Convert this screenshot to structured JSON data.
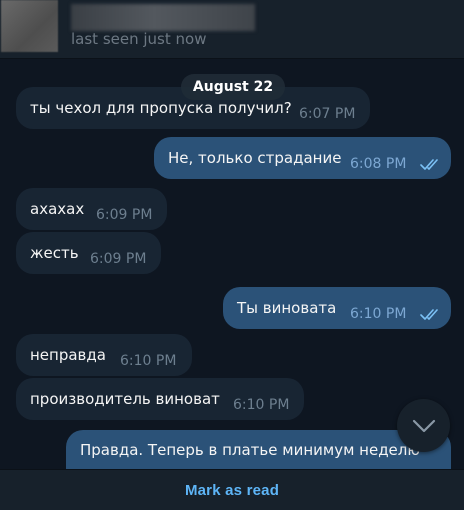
{
  "header": {
    "status": "last seen just now"
  },
  "chat": {
    "date_divider": "August 22",
    "messages": [
      {
        "text": "ты чехол для пропуска получил?",
        "time": "6:07 PM",
        "direction": "incoming"
      },
      {
        "text": "Не, только страдание",
        "time": "6:08 PM",
        "direction": "outgoing",
        "read": true
      },
      {
        "text": "ахахах",
        "time": "6:09 PM",
        "direction": "incoming"
      },
      {
        "text": "жесть",
        "time": "6:09 PM",
        "direction": "incoming"
      },
      {
        "text": "Ты виновата",
        "time": "6:10 PM",
        "direction": "outgoing",
        "read": true
      },
      {
        "text": "неправда",
        "time": "6:10 PM",
        "direction": "incoming"
      },
      {
        "text": "производитель виноват",
        "time": "6:10 PM",
        "direction": "incoming"
      },
      {
        "text": "Правда. Теперь в платье минимум неделю",
        "time": "",
        "direction": "outgoing"
      }
    ],
    "scroll_down_icon": "chevron-down-icon"
  },
  "footer": {
    "mark_as_read_label": "Mark as read"
  },
  "colors": {
    "background": "#0e1621",
    "panel": "#17212b",
    "incoming_bubble": "#182533",
    "outgoing_bubble": "#2b5278",
    "accent": "#5eb5f7",
    "read_check": "#7cc1f5"
  }
}
